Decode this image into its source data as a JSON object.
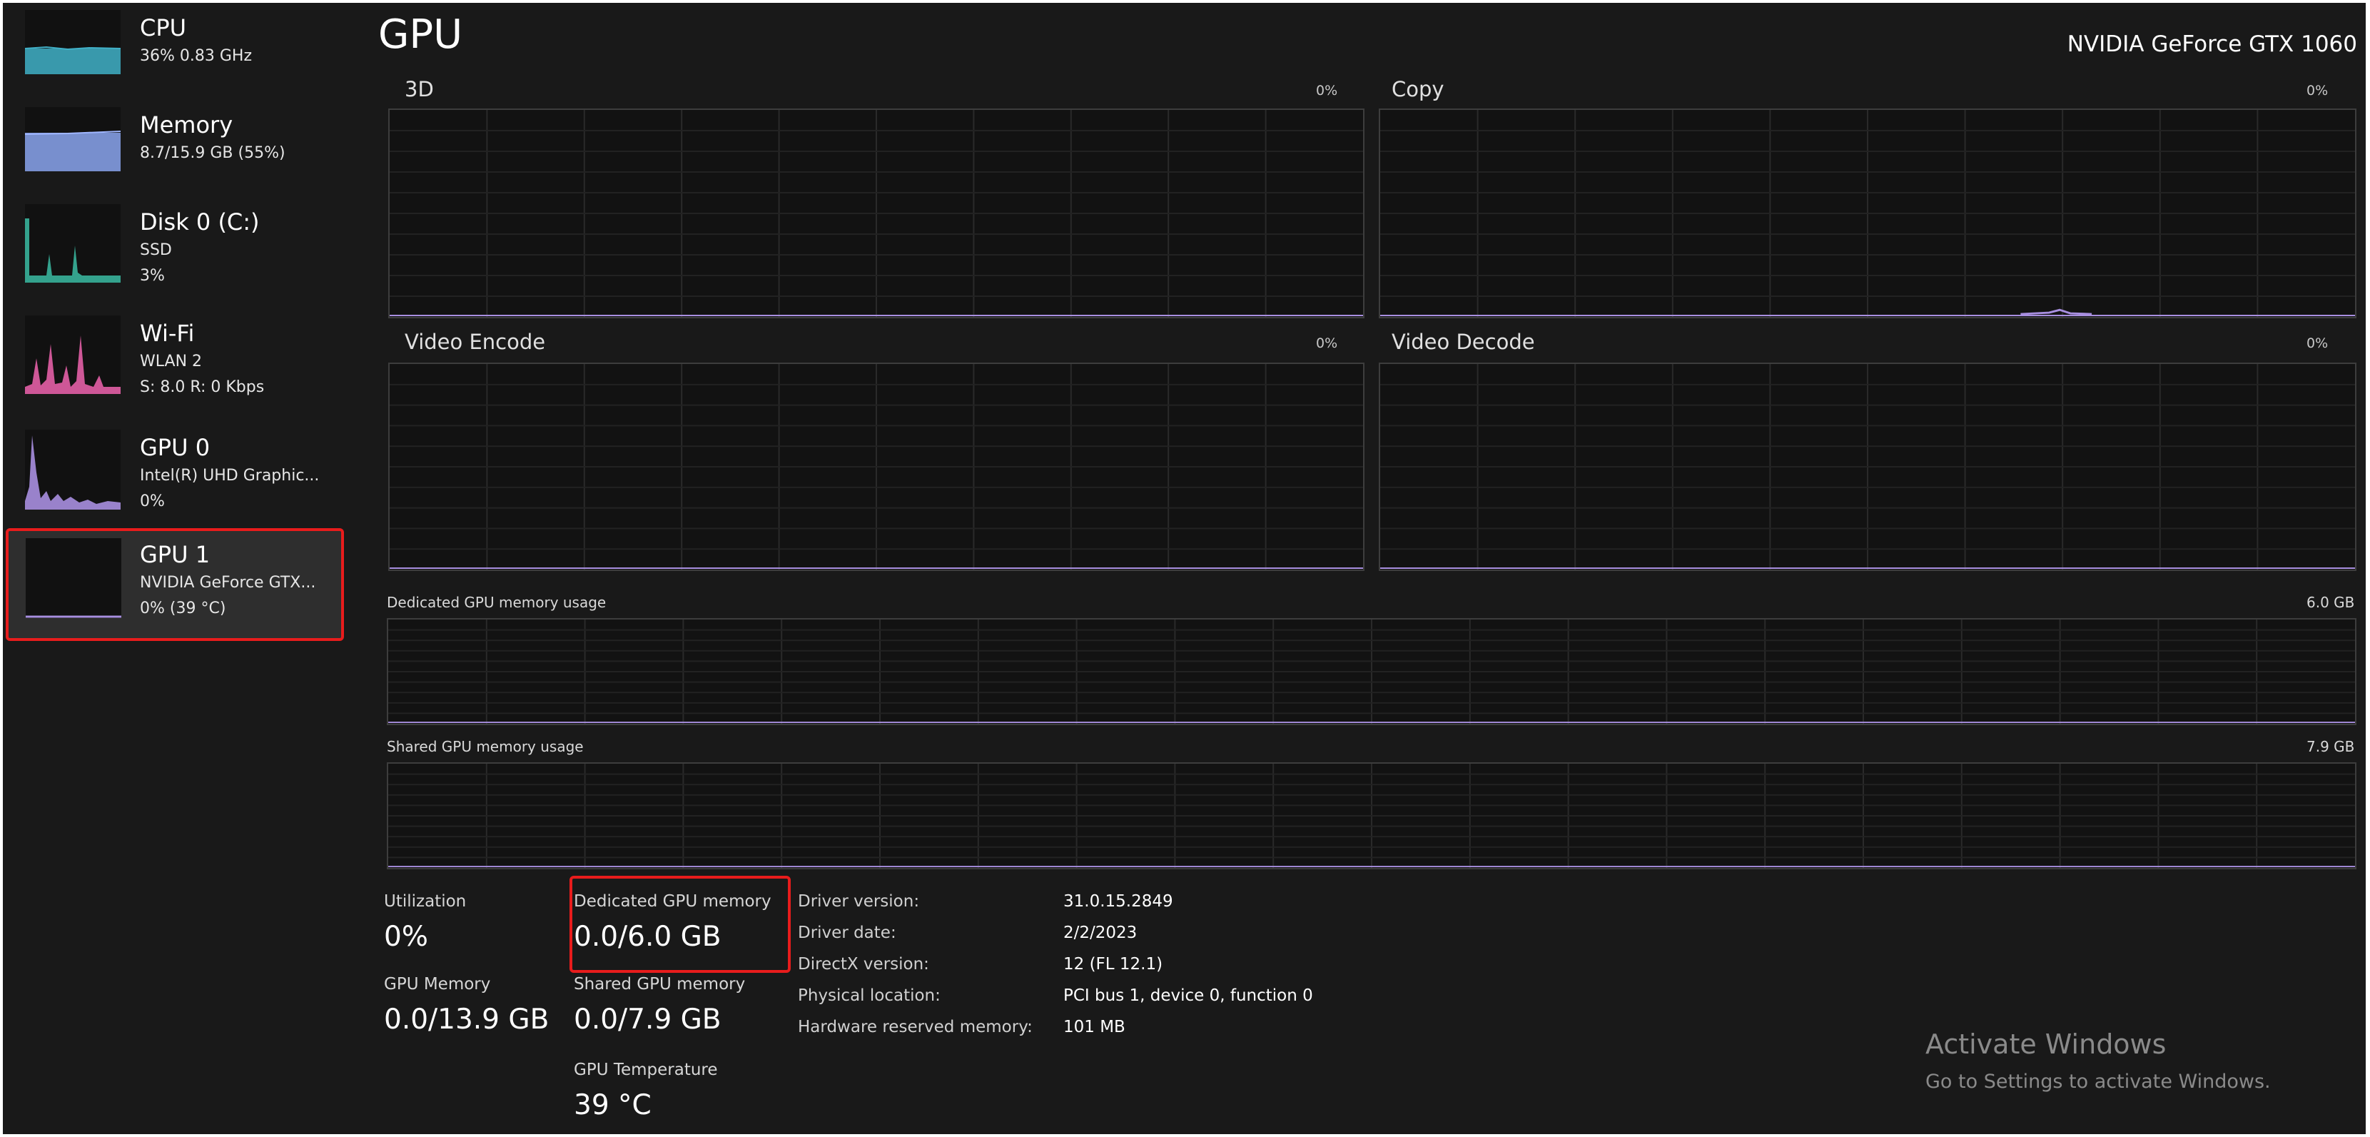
{
  "window": {
    "title": "GPU",
    "device_name": "NVIDIA GeForce GTX 1060"
  },
  "sidebar": {
    "items": [
      {
        "name": "CPU",
        "sub1": "36% 0.83 GHz",
        "sub2": "",
        "color": "#41b1c8"
      },
      {
        "name": "Memory",
        "sub1": "8.7/15.9 GB (55%)",
        "sub2": "",
        "color": "#8ba6f0"
      },
      {
        "name": "Disk 0 (C:)",
        "sub1": "SSD",
        "sub2": "3%",
        "color": "#38b29b"
      },
      {
        "name": "Wi-Fi",
        "sub1": "WLAN 2",
        "sub2": "S: 8.0 R: 0 Kbps",
        "color": "#e35fa6"
      },
      {
        "name": "GPU 0",
        "sub1": "Intel(R) UHD Graphic...",
        "sub2": "0%",
        "color": "#a88fe0"
      },
      {
        "name": "GPU 1",
        "sub1": "NVIDIA GeForce GTX...",
        "sub2": "0% (39 °C)",
        "color": "#a88fe0",
        "selected": true
      }
    ]
  },
  "panes": {
    "p3d": {
      "label": "3D",
      "pct": "0%"
    },
    "copy": {
      "label": "Copy",
      "pct": "0%"
    },
    "encode": {
      "label": "Video Encode",
      "pct": "0%"
    },
    "decode": {
      "label": "Video Decode",
      "pct": "0%"
    },
    "dedicated": {
      "label": "Dedicated GPU memory usage",
      "max": "6.0 GB"
    },
    "shared": {
      "label": "Shared GPU memory usage",
      "max": "7.9 GB"
    }
  },
  "stats": {
    "utilization_label": "Utilization",
    "utilization_value": "0%",
    "dedicated_label": "Dedicated GPU memory",
    "dedicated_value": "0.0/6.0 GB",
    "gpu_memory_label": "GPU Memory",
    "gpu_memory_value": "0.0/13.9 GB",
    "shared_label": "Shared GPU memory",
    "shared_value": "0.0/7.9 GB",
    "temp_label": "GPU Temperature",
    "temp_value": "39 °C"
  },
  "driver": [
    {
      "key": "Driver version:",
      "value": "31.0.15.2849"
    },
    {
      "key": "Driver date:",
      "value": "2/2/2023"
    },
    {
      "key": "DirectX version:",
      "value": "12 (FL 12.1)"
    },
    {
      "key": "Physical location:",
      "value": "PCI bus 1, device 0, function 0"
    },
    {
      "key": "Hardware reserved memory:",
      "value": "101 MB"
    }
  ],
  "watermark": {
    "title": "Activate Windows",
    "subtitle": "Go to Settings to activate Windows."
  },
  "colors": {
    "background": "#191919",
    "highlight": "#e81c1c",
    "grid": "#2c2c2c",
    "graph_line": "#a88fe0"
  }
}
